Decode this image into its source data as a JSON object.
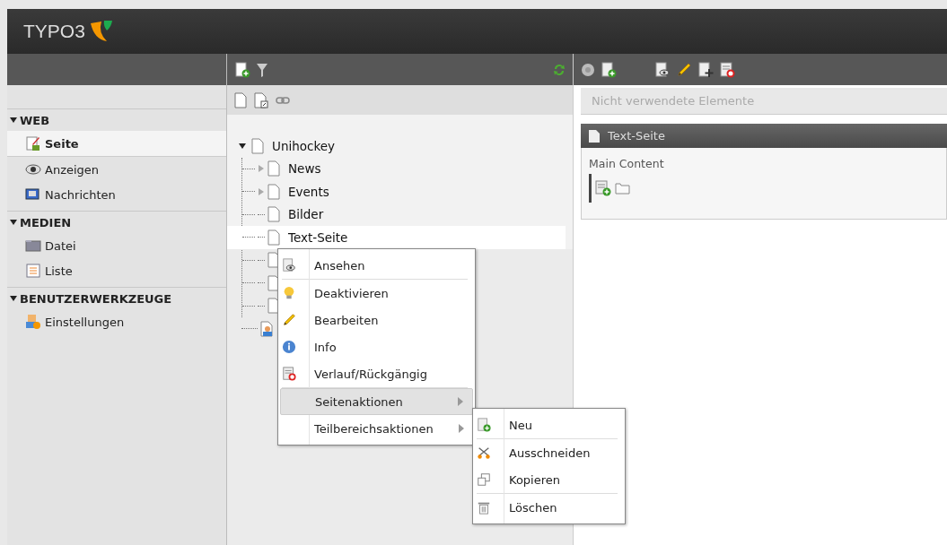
{
  "header": {
    "logo": "TYPO3"
  },
  "modules": [
    {
      "title": "WEB",
      "expanded": true,
      "items": [
        {
          "label": "Seite",
          "selected": true
        },
        {
          "label": "Anzeigen",
          "selected": false
        },
        {
          "label": "Nachrichten",
          "selected": false
        }
      ]
    },
    {
      "title": "MEDIEN",
      "expanded": true,
      "items": [
        {
          "label": "Datei",
          "selected": false
        },
        {
          "label": "Liste",
          "selected": false
        }
      ]
    },
    {
      "title": "BENUTZERWERKZEUGE",
      "expanded": true,
      "items": [
        {
          "label": "Einstellungen",
          "selected": false
        }
      ]
    }
  ],
  "tree": {
    "root": {
      "label": "Unihockey",
      "expanded": true,
      "children": [
        {
          "kind": "page",
          "label": "News",
          "expandable": true,
          "selected": false
        },
        {
          "kind": "page",
          "label": "Events",
          "expandable": true,
          "selected": false
        },
        {
          "kind": "page",
          "label": "Bilder",
          "expandable": false,
          "selected": false
        },
        {
          "kind": "page",
          "label": "Text-Seite",
          "expandable": false,
          "selected": true
        },
        {
          "kind": "covered"
        },
        {
          "kind": "covered"
        },
        {
          "kind": "covered"
        }
      ]
    },
    "extra_root": {
      "kind": "user"
    }
  },
  "content": {
    "unused_bar": "Nicht verwendete Elemente",
    "page_title": "Text-Seite",
    "column": "Main Content"
  },
  "context_menu": [
    {
      "kind": "item",
      "label": "Ansehen",
      "selected": false
    },
    {
      "kind": "separator"
    },
    {
      "kind": "item",
      "label": "Deaktivieren",
      "selected": false
    },
    {
      "kind": "item",
      "label": "Bearbeiten",
      "selected": false
    },
    {
      "kind": "item",
      "label": "Info",
      "selected": false
    },
    {
      "kind": "item",
      "label": "Verlauf/Rückgängig",
      "selected": false
    },
    {
      "kind": "separator"
    },
    {
      "kind": "submenu",
      "label": "Seitenaktionen",
      "selected": true
    },
    {
      "kind": "submenu",
      "label": "Teilbereichsaktionen",
      "selected": false
    }
  ],
  "submenu": [
    {
      "kind": "item",
      "label": "Neu"
    },
    {
      "kind": "separator"
    },
    {
      "kind": "item",
      "label": "Ausschneiden"
    },
    {
      "kind": "item",
      "label": "Kopieren"
    },
    {
      "kind": "separator"
    },
    {
      "kind": "item",
      "label": "Löschen"
    }
  ]
}
